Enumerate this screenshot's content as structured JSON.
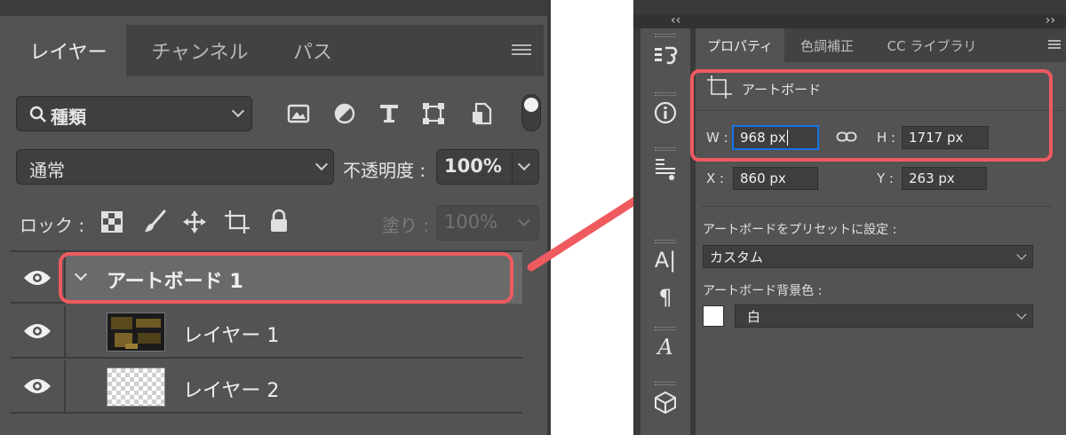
{
  "layers_panel": {
    "tabs": [
      "レイヤー",
      "チャンネル",
      "パス"
    ],
    "filter": {
      "label": "種類"
    },
    "filter_icons": [
      "image-filter-icon",
      "adjustment-filter-icon",
      "type-filter-icon",
      "shape-filter-icon",
      "smart-object-filter-icon"
    ],
    "blend_mode": "通常",
    "opacity_label": "不透明度 :",
    "opacity_value": "100%",
    "lock_label": "ロック :",
    "lock_icons": [
      "lock-transparent-pixels-icon",
      "lock-image-pixels-icon",
      "lock-position-icon",
      "lock-artboard-icon",
      "lock-all-icon"
    ],
    "fill_label": "塗り :",
    "fill_value": "100%",
    "layers": [
      {
        "name": "アートボード 1",
        "type": "artboard",
        "expanded": true
      },
      {
        "name": "レイヤー 1",
        "type": "pixel-layer"
      },
      {
        "name": "レイヤー 2",
        "type": "transparent-layer"
      }
    ]
  },
  "properties_panel": {
    "collapse_left": "‹‹",
    "collapse_right": "››",
    "tabs": [
      "プロパティ",
      "色調補正",
      "CC ライブラリ"
    ],
    "section_title": "アートボード",
    "w_label": "W :",
    "w_value": "968 px",
    "h_label": "H :",
    "h_value": "1717 px",
    "x_label": "X :",
    "x_value": "860 px",
    "y_label": "Y :",
    "y_value": "263 px",
    "preset_label": "アートボードをプリセットに設定 :",
    "preset_value": "カスタム",
    "bg_label": "アートボード背景色 :",
    "bg_value": "白"
  },
  "colors": {
    "panel_bg": "#535353",
    "highlight": "#ef5a5f",
    "selected_layer": "#6a6a6a",
    "focus_blue": "#1473e6"
  }
}
